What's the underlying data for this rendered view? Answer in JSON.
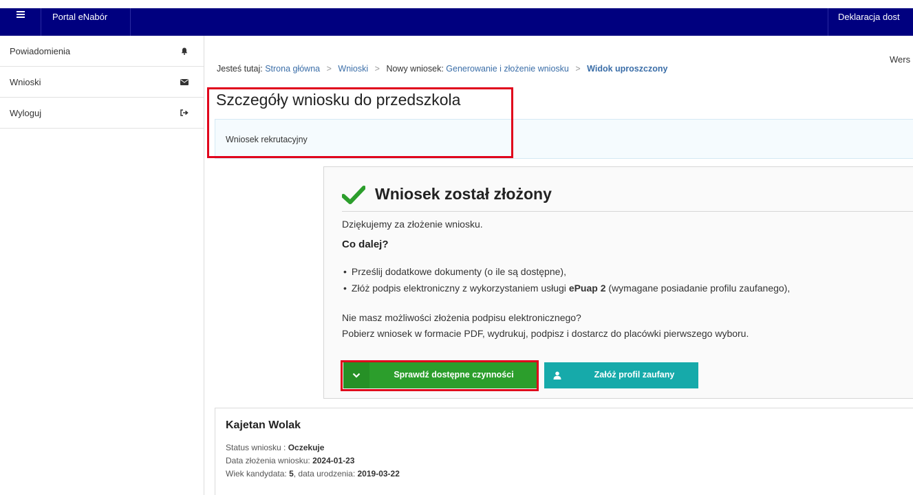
{
  "topbar": {
    "brand": "Portal eNabór",
    "right_link": "Deklaracja dost"
  },
  "sidebar": {
    "items": [
      {
        "label": "Powiadomienia",
        "icon": "bell-icon"
      },
      {
        "label": "Wnioski",
        "icon": "envelope-icon"
      },
      {
        "label": "Wyloguj",
        "icon": "sign-out-icon"
      }
    ]
  },
  "header": {
    "version": "Wers"
  },
  "breadcrumb": {
    "prefix": "Jesteś tutaj:",
    "home": "Strona główna",
    "requests": "Wnioski",
    "new_request_prefix": "Nowy wniosek:",
    "generate": "Generowanie i złożenie wniosku",
    "current": "Widok uproszczony"
  },
  "page": {
    "title": "Szczegóły wniosku do przedszkola",
    "info": "Wniosek rekrutacyjny"
  },
  "success": {
    "title": "Wniosek został złożony",
    "thanks": "Dziękujemy za złożenie wniosku.",
    "next_heading": "Co dalej?",
    "bullet_1": "Prześlij dodatkowe dokumenty (o ile są dostępne),",
    "bullet_2_pre": "Złóż podpis elektroniczny z wykorzystaniem usługi ",
    "bullet_2_bold": "ePuap 2",
    "bullet_2_post": " (wymagane posiadanie profilu zaufanego),",
    "no_signature": "Nie masz możliwości złożenia podpisu elektronicznego?",
    "download": "Pobierz wniosek w formacie PDF, wydrukuj, podpisz i dostarcz do placówki pierwszego wyboru.",
    "check_actions_button": "Sprawdź dostępne czynności",
    "trusted_profile_button": "Załóż profil zaufany"
  },
  "candidate": {
    "name": "Kajetan Wolak",
    "status_label": "Status wniosku :",
    "status_value": "Oczekuje",
    "date_label": "Data złożenia wniosku:",
    "date_value": "2024-01-23",
    "age_label": "Wiek kandydata:",
    "age_value": "5",
    "birth_label": ", data urodzenia:",
    "birth_value": "2019-03-22"
  },
  "colors": {
    "topbar": "#00007f",
    "success_green": "#2c9e2c",
    "teal": "#16aaaa",
    "highlight_red": "#e0001b",
    "link": "#3b6ea8"
  }
}
